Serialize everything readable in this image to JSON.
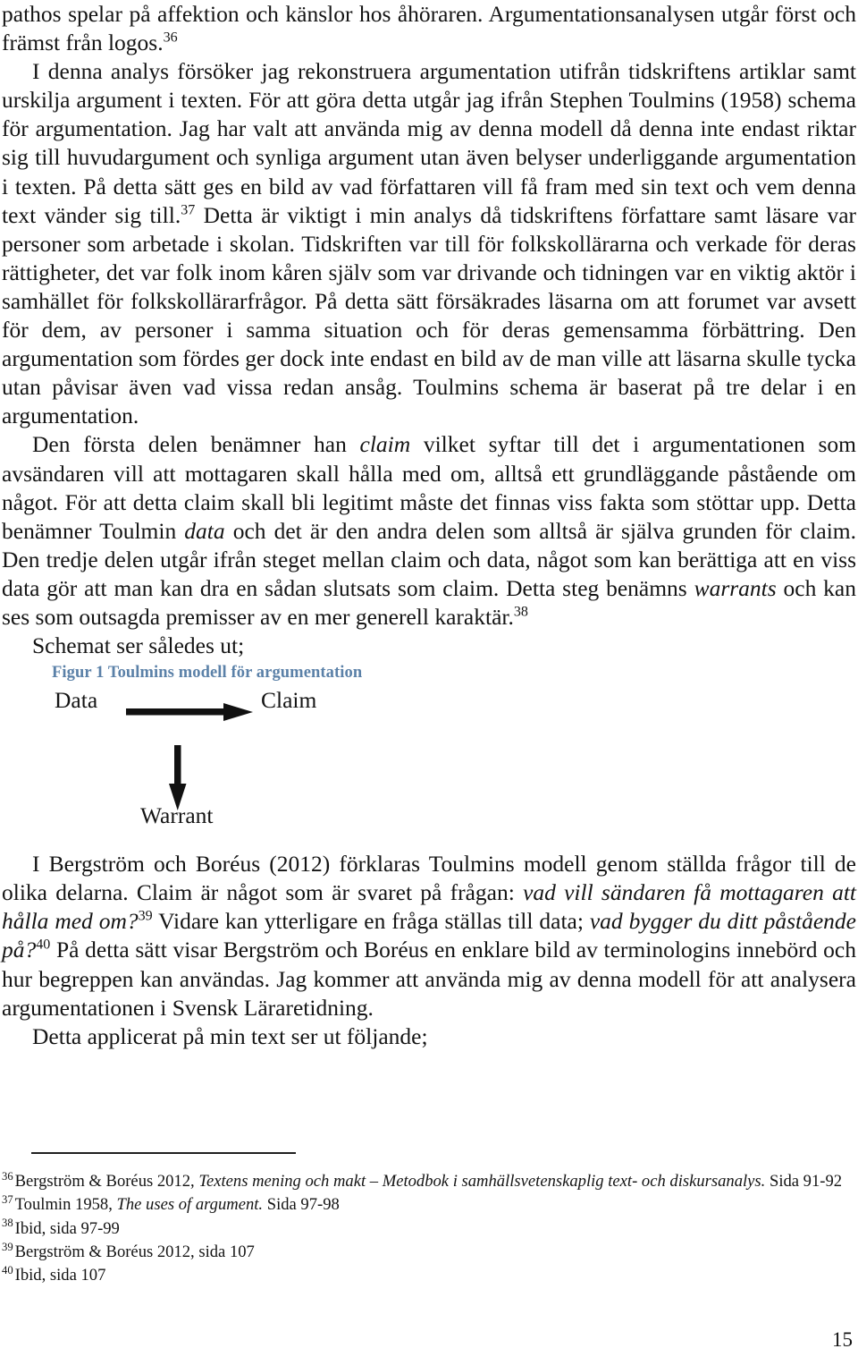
{
  "document": {
    "page_number": "15",
    "language": "sv",
    "accent_color": "#5b81a8"
  },
  "body": {
    "paragraphs": [
      {
        "id": "p1",
        "indent": false,
        "runs": [
          {
            "type": "text",
            "text": "pathos spelar på affektion och känslor hos åhöraren. Argumentationsanalysen utgår först och främst från logos."
          },
          {
            "type": "sup",
            "text": "36"
          }
        ]
      },
      {
        "id": "p2",
        "indent": true,
        "runs": [
          {
            "type": "text",
            "text": "I denna analys försöker jag rekonstruera argumentation utifrån tidskriftens artiklar samt urskilja argument i texten. För att göra detta utgår jag ifrån Stephen Toulmins (1958) schema för argumentation. Jag har valt att använda mig av denna modell då denna inte endast riktar sig till huvudargument och synliga argument utan även belyser underliggande argumentation i texten. På detta sätt ges en bild av vad författaren vill få fram med sin text och vem denna text vänder sig till."
          },
          {
            "type": "sup",
            "text": "37"
          },
          {
            "type": "text",
            "text": " Detta är viktigt i min analys då tidskriftens författare samt läsare var personer som arbetade i skolan. Tidskriften var till för folkskollärarna och verkade för deras rättigheter, det var folk inom kåren själv som var drivande och tidningen var en viktig aktör i samhället för folkskollärarfrågor. På detta sätt försäkrades läsarna om att forumet var avsett för dem, av personer i samma situation och för deras gemensamma förbättring. Den argumentation som fördes ger dock inte endast en bild av de man ville att läsarna skulle tycka utan påvisar även vad vissa redan ansåg. Toulmins schema är baserat på tre delar i en argumentation."
          }
        ]
      },
      {
        "id": "p3",
        "indent": true,
        "runs": [
          {
            "type": "text",
            "text": "Den första delen benämner han "
          },
          {
            "type": "italic",
            "text": "claim"
          },
          {
            "type": "text",
            "text": " vilket syftar till det i argumentationen som avsändaren vill att mottagaren skall hålla med om, alltså ett grundläggande påstående om något. För att detta claim skall bli legitimt måste det finnas viss fakta som stöttar upp. Detta benämner Toulmin "
          },
          {
            "type": "italic",
            "text": "data"
          },
          {
            "type": "text",
            "text": " och det är den andra delen som alltså är själva grunden för claim.  Den tredje delen utgår ifrån steget mellan claim och data, något som kan berättiga att en viss data gör att man kan dra en sådan slutsats som claim. Detta steg benämns "
          },
          {
            "type": "italic",
            "text": "warrants"
          },
          {
            "type": "text",
            "text": " och kan ses som outsagda premisser av en mer generell karaktär."
          },
          {
            "type": "sup",
            "text": "38"
          }
        ]
      },
      {
        "id": "p4",
        "indent": true,
        "runs": [
          {
            "type": "text",
            "text": "Schemat ser således ut;"
          }
        ]
      },
      {
        "id": "p5",
        "indent": true,
        "runs": [
          {
            "type": "text",
            "text": "I Bergström och Boréus (2012) förklaras Toulmins modell genom ställda frågor till de olika delarna. Claim är något som är svaret på frågan: "
          },
          {
            "type": "italic",
            "text": "vad vill sändaren få mottagaren att hålla med om?"
          },
          {
            "type": "sup",
            "text": "39"
          },
          {
            "type": "text",
            "text": " Vidare kan ytterligare en fråga ställas till data; "
          },
          {
            "type": "italic",
            "text": "vad bygger du ditt påstående på?"
          },
          {
            "type": "sup",
            "text": "40"
          },
          {
            "type": "text",
            "text": " På detta sätt visar Bergström och Boréus en enklare bild av terminologins innebörd och hur begreppen kan användas. Jag kommer att använda mig av denna modell för att analysera argumentationen i Svensk Läraretidning."
          }
        ]
      },
      {
        "id": "p6",
        "indent": true,
        "runs": [
          {
            "type": "text",
            "text": "Detta applicerat på min text ser ut följande;"
          }
        ]
      }
    ]
  },
  "figure": {
    "caption": "Figur 1 Toulmins modell för argumentation",
    "nodes": {
      "data": "Data",
      "claim": "Claim",
      "warrant": "Warrant"
    },
    "arrows": [
      {
        "name": "data-to-claim-arrow",
        "direction": "right"
      },
      {
        "name": "data-to-warrant-arrow",
        "direction": "down"
      }
    ]
  },
  "footnotes": [
    {
      "number": "36",
      "runs": [
        {
          "type": "text",
          "text": "Bergström & Boréus 2012, "
        },
        {
          "type": "italic",
          "text": "Textens mening och makt – Metodbok i samhällsvetenskaplig text- och diskursanalys."
        },
        {
          "type": "text",
          "text": " Sida 91-92"
        }
      ]
    },
    {
      "number": "37",
      "runs": [
        {
          "type": "text",
          "text": "Toulmin 1958, "
        },
        {
          "type": "italic",
          "text": "The uses of argument."
        },
        {
          "type": "text",
          "text": " Sida 97-98"
        }
      ]
    },
    {
      "number": "38",
      "runs": [
        {
          "type": "text",
          "text": "Ibid, sida 97-99"
        }
      ]
    },
    {
      "number": "39",
      "runs": [
        {
          "type": "text",
          "text": "Bergström & Boréus 2012, sida 107"
        }
      ]
    },
    {
      "number": "40",
      "runs": [
        {
          "type": "text",
          "text": "Ibid, sida 107"
        }
      ]
    }
  ]
}
